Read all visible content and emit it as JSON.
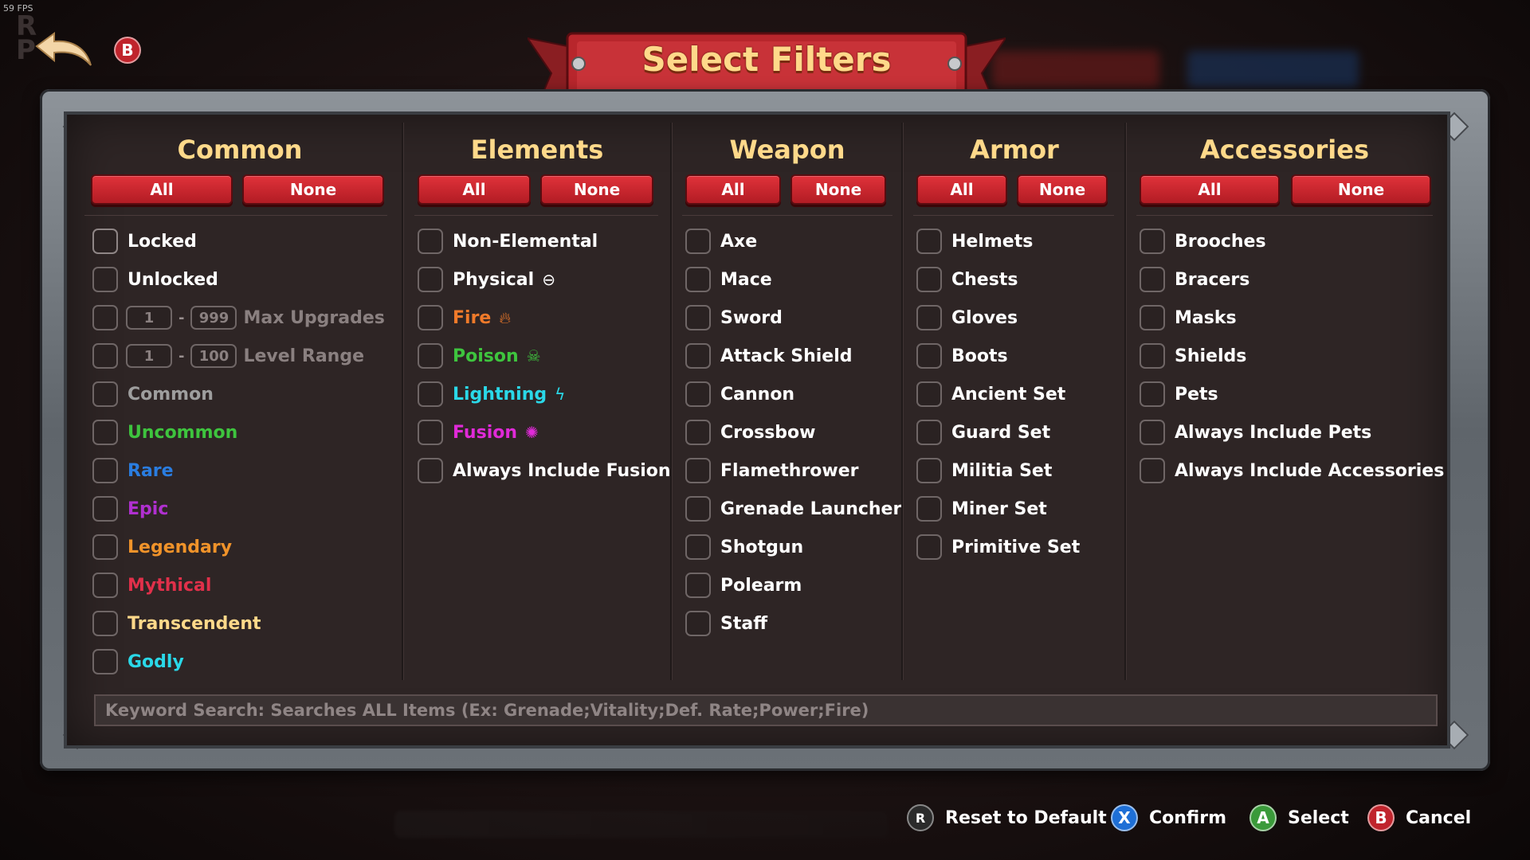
{
  "fps": "59 FPS",
  "header": {
    "back_button_glyph": "B",
    "title": "Select Filters"
  },
  "columns": {
    "common": {
      "title": "Common",
      "all_label": "All",
      "none_label": "None",
      "items": [
        {
          "label": "Locked",
          "color": "#ffffff"
        },
        {
          "label": "Unlocked",
          "color": "#ffffff"
        },
        {
          "label": "Common",
          "color": "#9e9e9e"
        },
        {
          "label": "Uncommon",
          "color": "#3ec43e"
        },
        {
          "label": "Rare",
          "color": "#2a7de0"
        },
        {
          "label": "Epic",
          "color": "#b030d0"
        },
        {
          "label": "Legendary",
          "color": "#f0932a"
        },
        {
          "label": "Mythical",
          "color": "#e0304a"
        },
        {
          "label": "Transcendent",
          "color": "#ffd98a"
        },
        {
          "label": "Godly",
          "color": "#2ad8e8"
        }
      ],
      "max_upgrades": {
        "min": "1",
        "max": "999",
        "label": "Max Upgrades"
      },
      "level_range": {
        "min": "1",
        "max": "100",
        "label": "Level Range"
      }
    },
    "elements": {
      "title": "Elements",
      "all_label": "All",
      "none_label": "None",
      "items": [
        {
          "label": "Non-Elemental",
          "color": "#ffffff",
          "icon": ""
        },
        {
          "label": "Physical",
          "color": "#ffffff",
          "icon": "⊖"
        },
        {
          "label": "Fire",
          "color": "#f07a2a",
          "icon": "🔥︎"
        },
        {
          "label": "Poison",
          "color": "#3ec43e",
          "icon": "☠"
        },
        {
          "label": "Lightning",
          "color": "#2ad8e8",
          "icon": "ϟ"
        },
        {
          "label": "Fusion",
          "color": "#e02ad8",
          "icon": "✺"
        },
        {
          "label": "Always Include Fusion",
          "color": "#ffffff",
          "icon": ""
        }
      ]
    },
    "weapon": {
      "title": "Weapon",
      "all_label": "All",
      "none_label": "None",
      "items": [
        "Axe",
        "Mace",
        "Sword",
        "Attack Shield",
        "Cannon",
        "Crossbow",
        "Flamethrower",
        "Grenade Launcher",
        "Shotgun",
        "Polearm",
        "Staff"
      ]
    },
    "armor": {
      "title": "Armor",
      "all_label": "All",
      "none_label": "None",
      "items": [
        "Helmets",
        "Chests",
        "Gloves",
        "Boots",
        "Ancient Set",
        "Guard Set",
        "Militia Set",
        "Miner Set",
        "Primitive Set"
      ]
    },
    "accessories": {
      "title": "Accessories",
      "all_label": "All",
      "none_label": "None",
      "items": [
        "Brooches",
        "Bracers",
        "Masks",
        "Shields",
        "Pets",
        "Always Include Pets",
        "Always Include Accessories"
      ]
    }
  },
  "search": {
    "placeholder": "Keyword Search: Searches ALL Items (Ex: Grenade;Vitality;Def. Rate;Power;Fire)"
  },
  "footer": {
    "reset": {
      "glyph": "R",
      "label": "Reset to Default"
    },
    "confirm": {
      "glyph": "X",
      "label": "Confirm"
    },
    "select": {
      "glyph": "A",
      "label": "Select"
    },
    "cancel": {
      "glyph": "B",
      "label": "Cancel"
    }
  },
  "colors": {
    "accent_title": "#ffd98a",
    "button_red": "#c8242c",
    "panel_bg": "#2e2525"
  }
}
